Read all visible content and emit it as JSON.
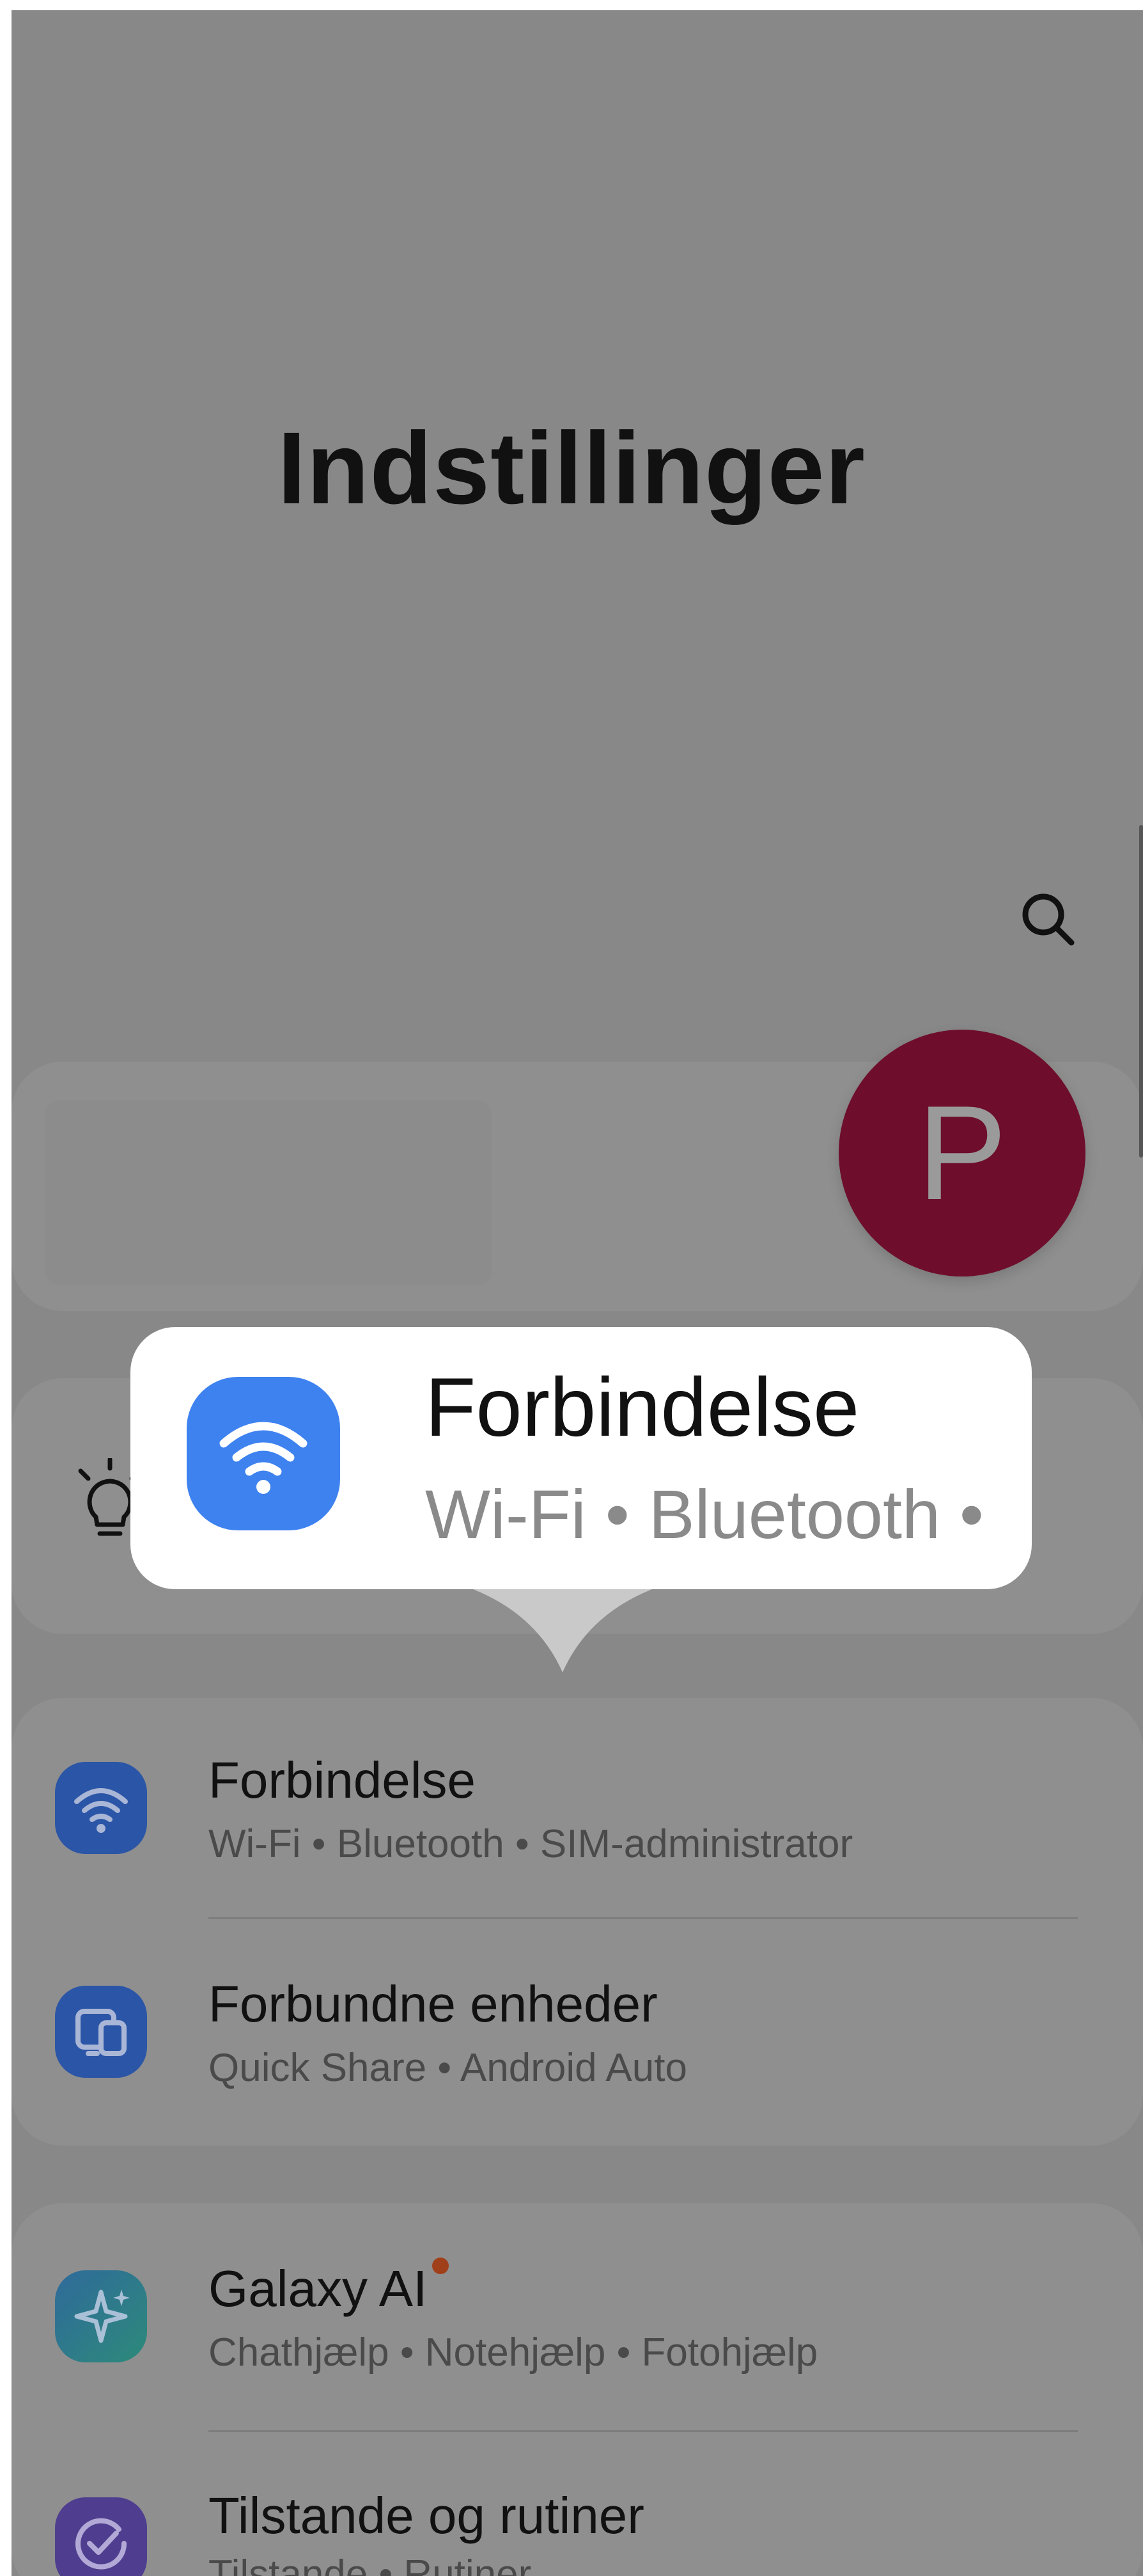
{
  "header": {
    "title": "Indstillinger"
  },
  "profile": {
    "initial": "P",
    "avatar_color": "#6e0e2c"
  },
  "tooltip": {
    "title": "Forbindelse",
    "subtitle": "Wi-Fi • Bluetooth •",
    "icon": "wifi-icon",
    "icon_color": "#3e82f0"
  },
  "settings": {
    "items": [
      {
        "title": "Forbindelse",
        "subtitle": "Wi-Fi • Bluetooth • SIM-administrator",
        "icon": "wifi-icon",
        "color": "#2b55a6"
      },
      {
        "title": "Forbundne enheder",
        "subtitle": "Quick Share • Android Auto",
        "icon": "devices-icon",
        "color": "#2b55a6"
      },
      {
        "title": "Galaxy AI",
        "subtitle": "Chathjælp • Notehjælp • Fotohjælp",
        "icon": "sparkle-icon",
        "color": "#2d6f8a",
        "badge": true
      },
      {
        "title": "Tilstande og rutiner",
        "subtitle": "Tilstande • Rutiner",
        "icon": "check-circle-icon",
        "color": "#4f3e8f"
      }
    ]
  },
  "icons": {
    "search": "search-icon",
    "tips": "lightbulb-icon"
  }
}
